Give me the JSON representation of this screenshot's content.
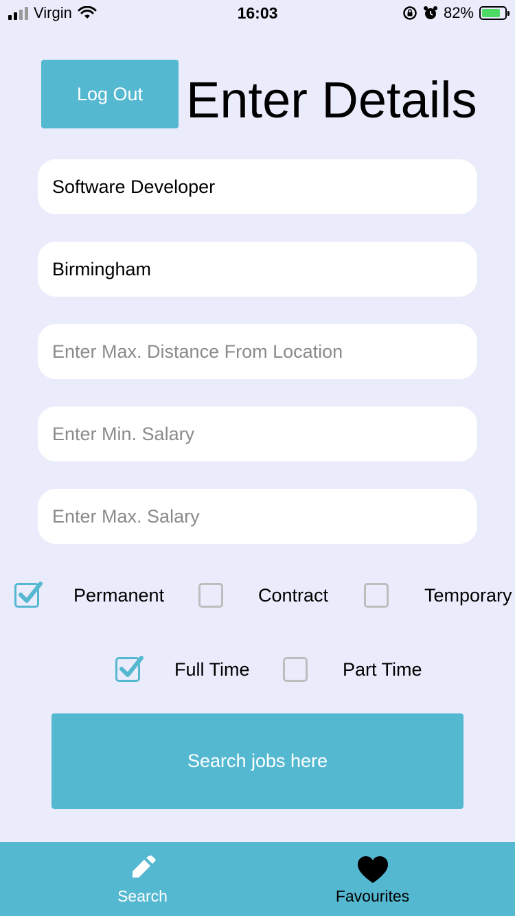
{
  "status_bar": {
    "carrier": "Virgin",
    "time": "16:03",
    "battery_percent": "82%",
    "battery_level": 0.82
  },
  "header": {
    "logout_label": "Log Out",
    "title": "Enter Details"
  },
  "form": {
    "job_title": {
      "value": "Software Developer",
      "placeholder": ""
    },
    "location": {
      "value": "Birmingham",
      "placeholder": ""
    },
    "max_distance": {
      "value": "",
      "placeholder": "Enter Max. Distance From Location"
    },
    "min_salary": {
      "value": "",
      "placeholder": "Enter Min. Salary"
    },
    "max_salary": {
      "value": "",
      "placeholder": "Enter Max. Salary"
    }
  },
  "contract_types": [
    {
      "label": "Permanent",
      "checked": true
    },
    {
      "label": "Contract",
      "checked": false
    },
    {
      "label": "Temporary",
      "checked": false
    }
  ],
  "hours": [
    {
      "label": "Full Time",
      "checked": true
    },
    {
      "label": "Part Time",
      "checked": false
    }
  ],
  "search_button_label": "Search jobs here",
  "tab_bar": {
    "tabs": [
      {
        "label": "Search",
        "icon": "pencil-icon",
        "active": true
      },
      {
        "label": "Favourites",
        "icon": "heart-icon",
        "active": false
      }
    ]
  },
  "colors": {
    "accent": "#55B8D1",
    "background": "#EAEBFB",
    "tab_active": "#FFFFFF",
    "tab_inactive": "#000000"
  }
}
